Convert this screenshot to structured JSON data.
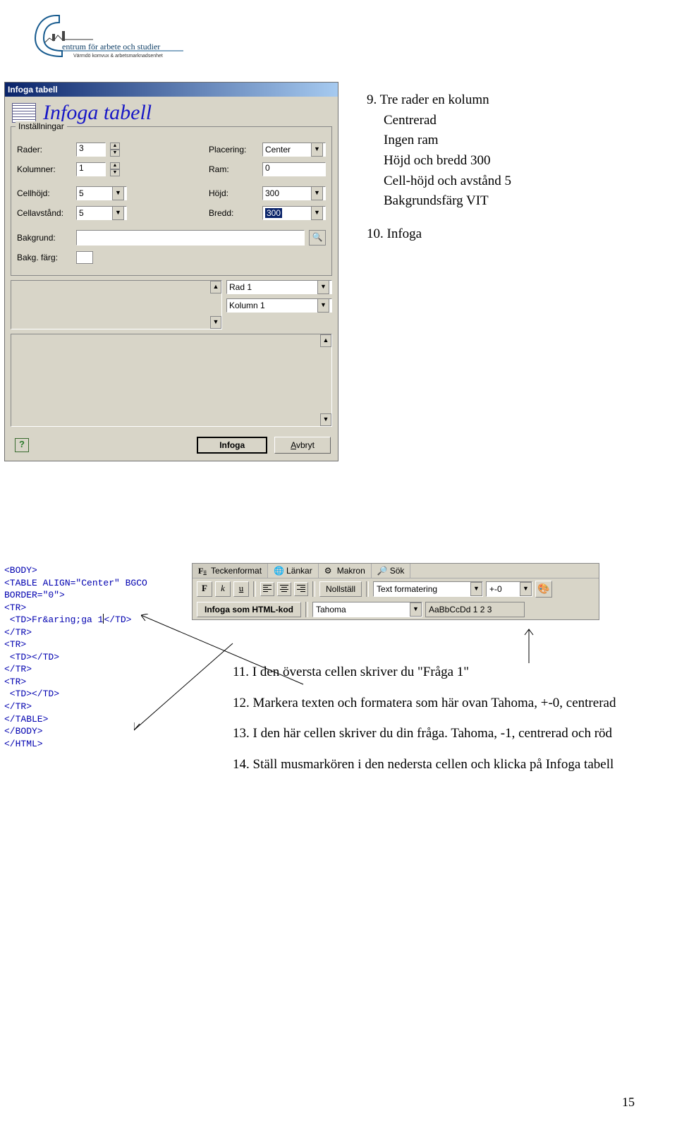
{
  "logo": {
    "line1": "entrum för arbete och studier",
    "line2": "Värmdö komvux & arbetsmarknadsenhet"
  },
  "dialog": {
    "title": "Infoga tabell",
    "header": "Infoga tabell",
    "group_title": "Inställningar",
    "rader_label": "Rader:",
    "rader_value": "3",
    "kolumner_label": "Kolumner:",
    "kolumner_value": "1",
    "placering_label": "Placering:",
    "placering_value": "Center",
    "ram_label": "Ram:",
    "ram_value": "0",
    "cellhojd_label": "Cellhöjd:",
    "cellhojd_value": "5",
    "hojd_label": "Höjd:",
    "hojd_value": "300",
    "cellavst_label": "Cellavstånd:",
    "cellavst_value": "5",
    "bredd_label": "Bredd:",
    "bredd_value": "300",
    "bakgrund_label": "Bakgrund:",
    "bakgfarg_label": "Bakg. färg:",
    "rad_select": "Rad 1",
    "kolumn_select": "Kolumn 1",
    "btn_insert": "Infoga",
    "btn_cancel": "Avbryt",
    "help": "?"
  },
  "instr": {
    "l1a": "9. Tre rader en kolumn",
    "l1b": "Centrerad",
    "l1c": "Ingen ram",
    "l1d": "Höjd och bredd 300",
    "l1e": "Cell-höjd och avstånd 5",
    "l1f": "Bakgrundsfärg VIT",
    "l2": "10. Infoga"
  },
  "code": {
    "l1": "<BODY>",
    "l2": "<TABLE ALIGN=\"Center\" BGCO",
    "l3": "BORDER=\"0\">",
    "l4": "<TR>",
    "l5_a": " <TD>Fr&aring;ga 1",
    "l5_b": "</TD>",
    "l6": "</TR>",
    "l7": "<TR>",
    "l8": " <TD></TD>",
    "l9": "</TR>",
    "l10": "<TR>",
    "l11": " <TD></TD>",
    "l12": "</TR>",
    "l13": "</TABLE>",
    "l14": "</BODY>",
    "l15": "</HTML>"
  },
  "toolbar": {
    "tab1": "Teckenformat",
    "tab2": "Länkar",
    "tab3": "Makron",
    "tab4": "Sök",
    "bold": "F",
    "italic": "k",
    "under": "u",
    "reset": "Nollställ",
    "insert_html": "Infoga som HTML-kod",
    "dd_format": "Text formatering",
    "dd_size": "+-0",
    "dd_font": "Tahoma",
    "dd_sample": "AaBbCcDd 1 2 3",
    "tab1_prefix": "F",
    "tab1_accel": "u"
  },
  "instr2": {
    "p11": "11. I den översta cellen skriver du \"Fråga 1\"",
    "p12": "12. Markera texten och formatera som här ovan Tahoma, +-0, centrerad",
    "p13": "13. I den här cellen skriver du din fråga. Tahoma, -1, centrerad och röd",
    "p14": "14. Ställ musmarkören i den nedersta cellen och klicka på Infoga tabell"
  },
  "page_number": "15",
  "chart_data": null
}
